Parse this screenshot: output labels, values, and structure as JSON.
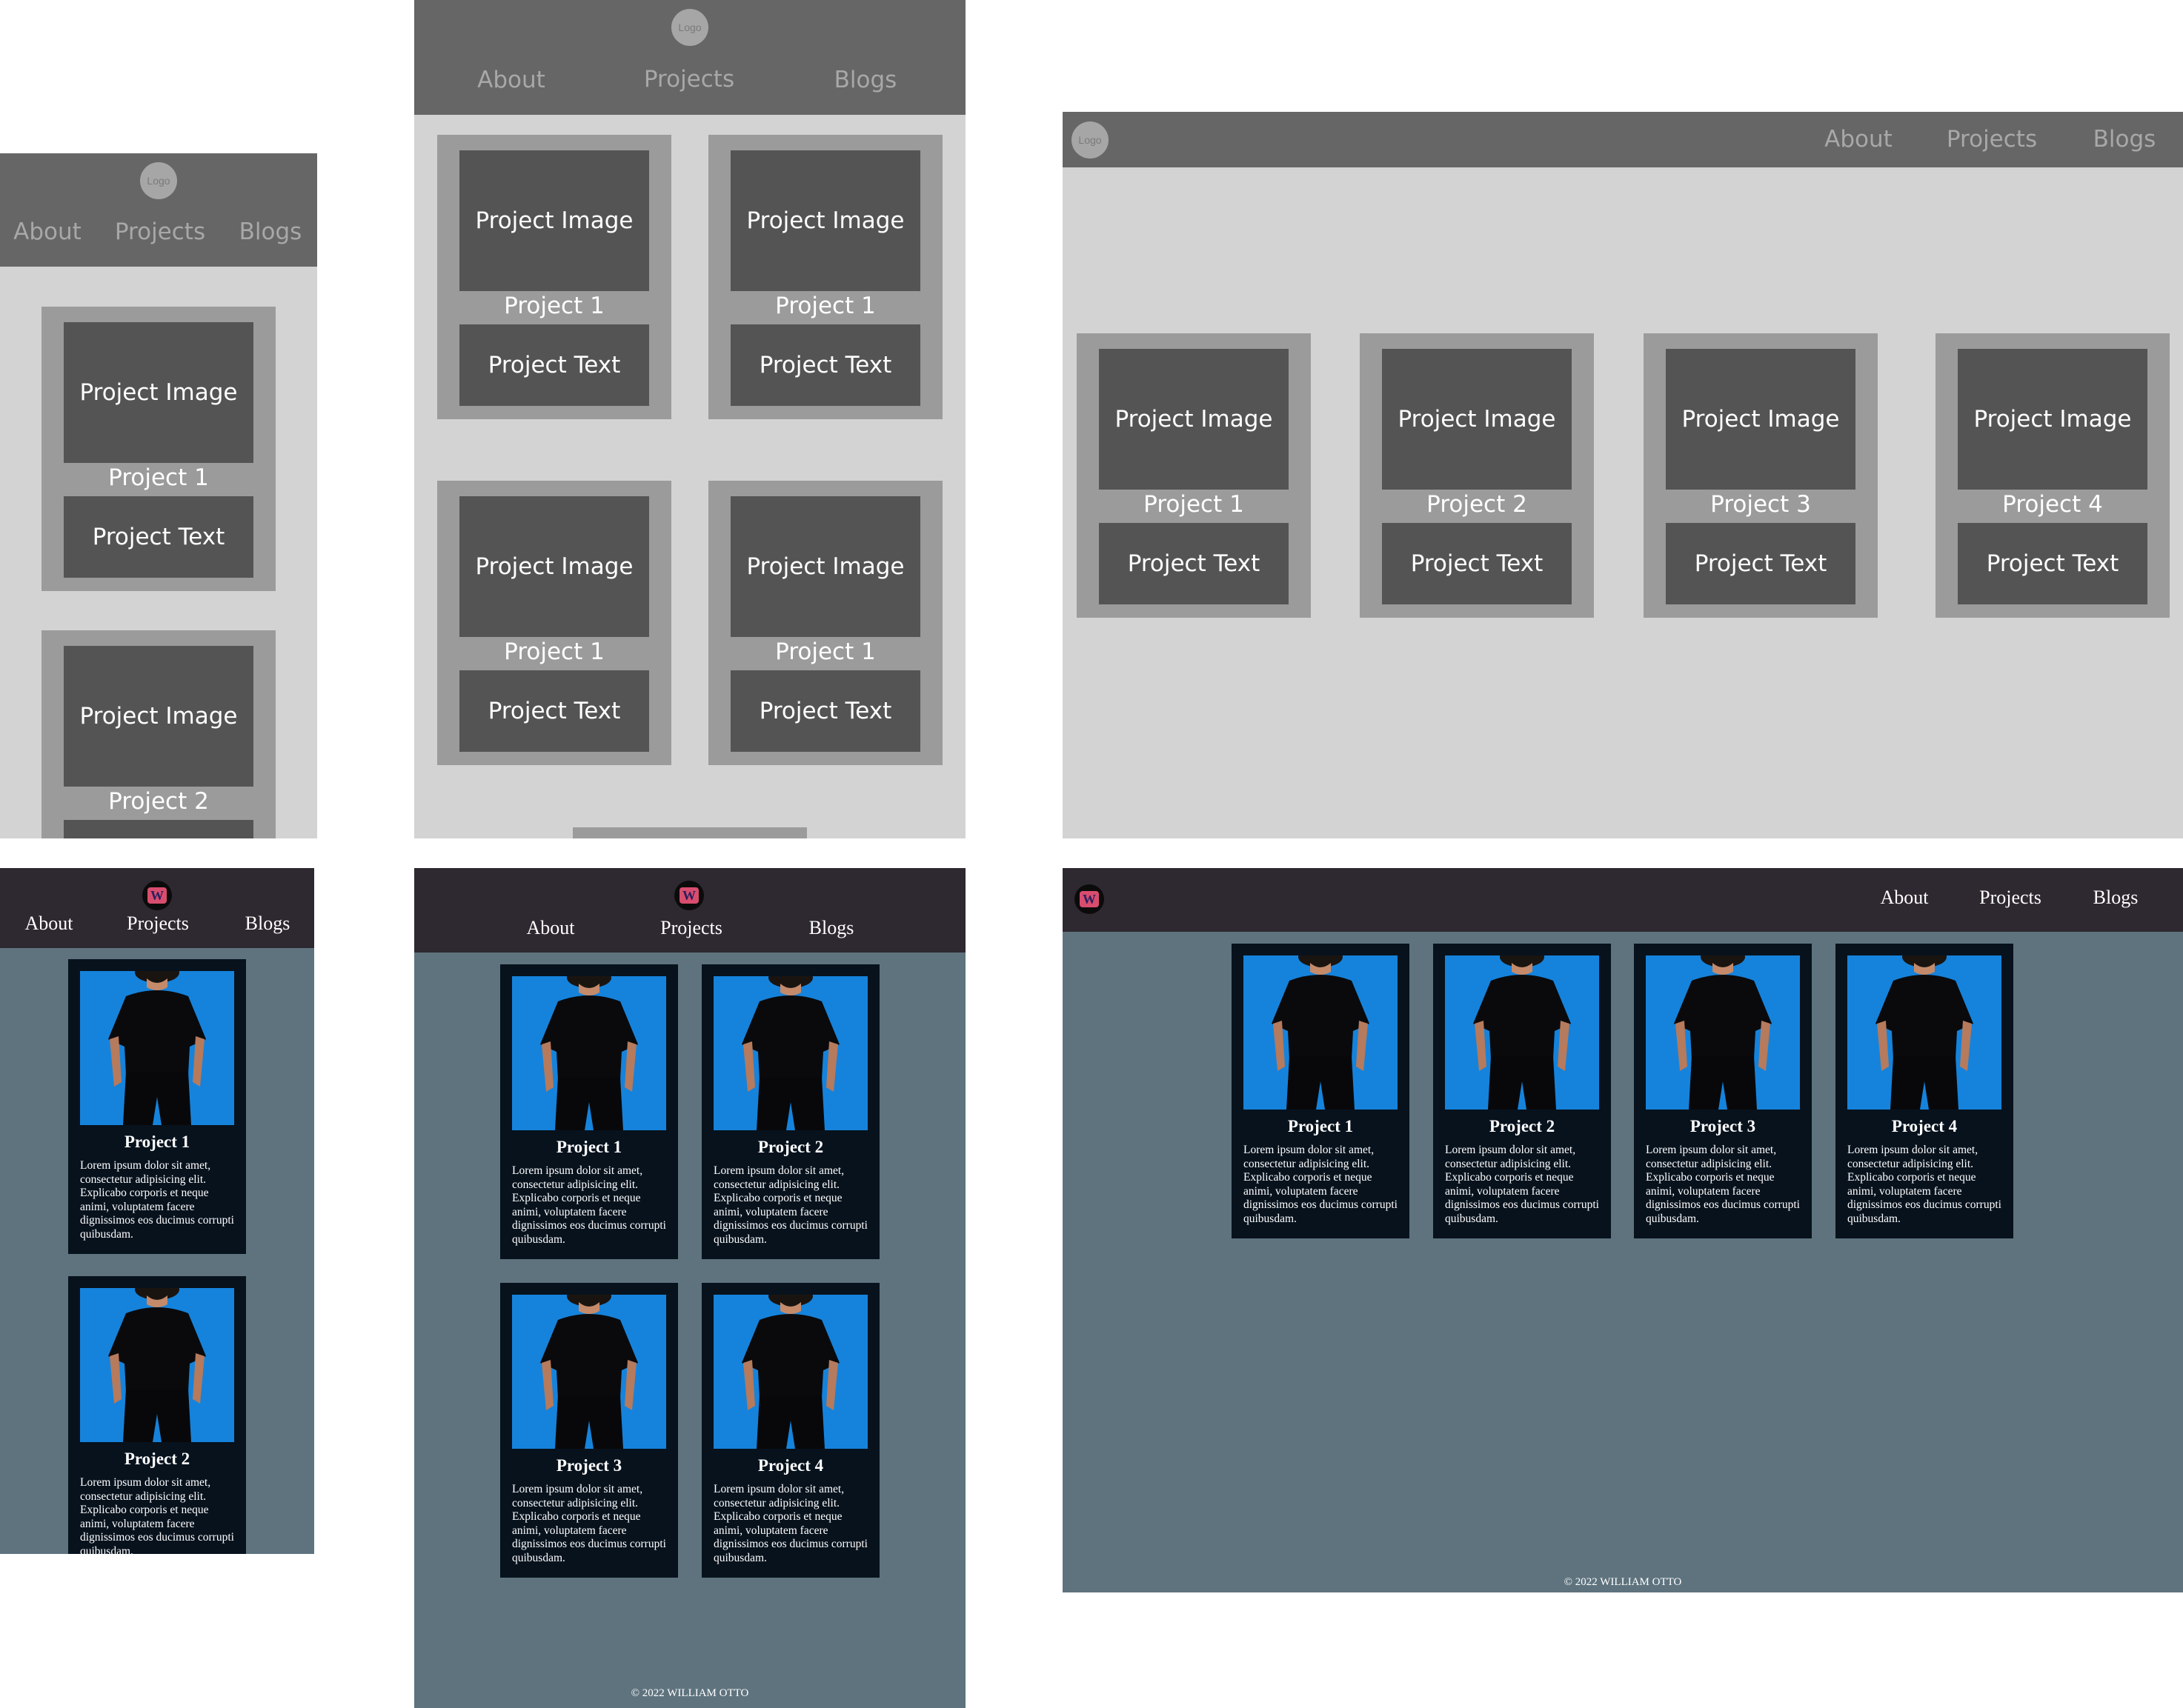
{
  "wireframe": {
    "logo_text": "Logo",
    "nav": [
      "About",
      "Projects",
      "Blogs"
    ],
    "image_label": "Project Image",
    "text_label": "Project Text",
    "mobile": {
      "titles": [
        "Project 1",
        "Project 2"
      ]
    },
    "tablet": {
      "titles": [
        "Project 1",
        "Project 1",
        "Project 1",
        "Project 1"
      ]
    },
    "desktop": {
      "titles": [
        "Project 1",
        "Project 2",
        "Project 3",
        "Project 4"
      ]
    }
  },
  "final": {
    "logo_letter": "W",
    "nav": [
      "About",
      "Projects",
      "Blogs"
    ],
    "card_body": "Lorem ipsum dolor sit amet, consectetur adipisicing elit. Explicabo corporis et neque animi, voluptatem facere dignissimos eos ducimus corrupti quibusdam.",
    "titles": [
      "Project 1",
      "Project 2",
      "Project 3",
      "Project 4"
    ],
    "footer": "© 2022 WILLIAM OTTO"
  },
  "colors": {
    "wireframe_bg": "#d3d3d3",
    "wireframe_nav": "#666666",
    "wireframe_box": "#545454",
    "final_bg": "#5e737e",
    "final_nav": "#2e2830",
    "final_card": "#07121d",
    "photo_blue": "#1a88df"
  }
}
